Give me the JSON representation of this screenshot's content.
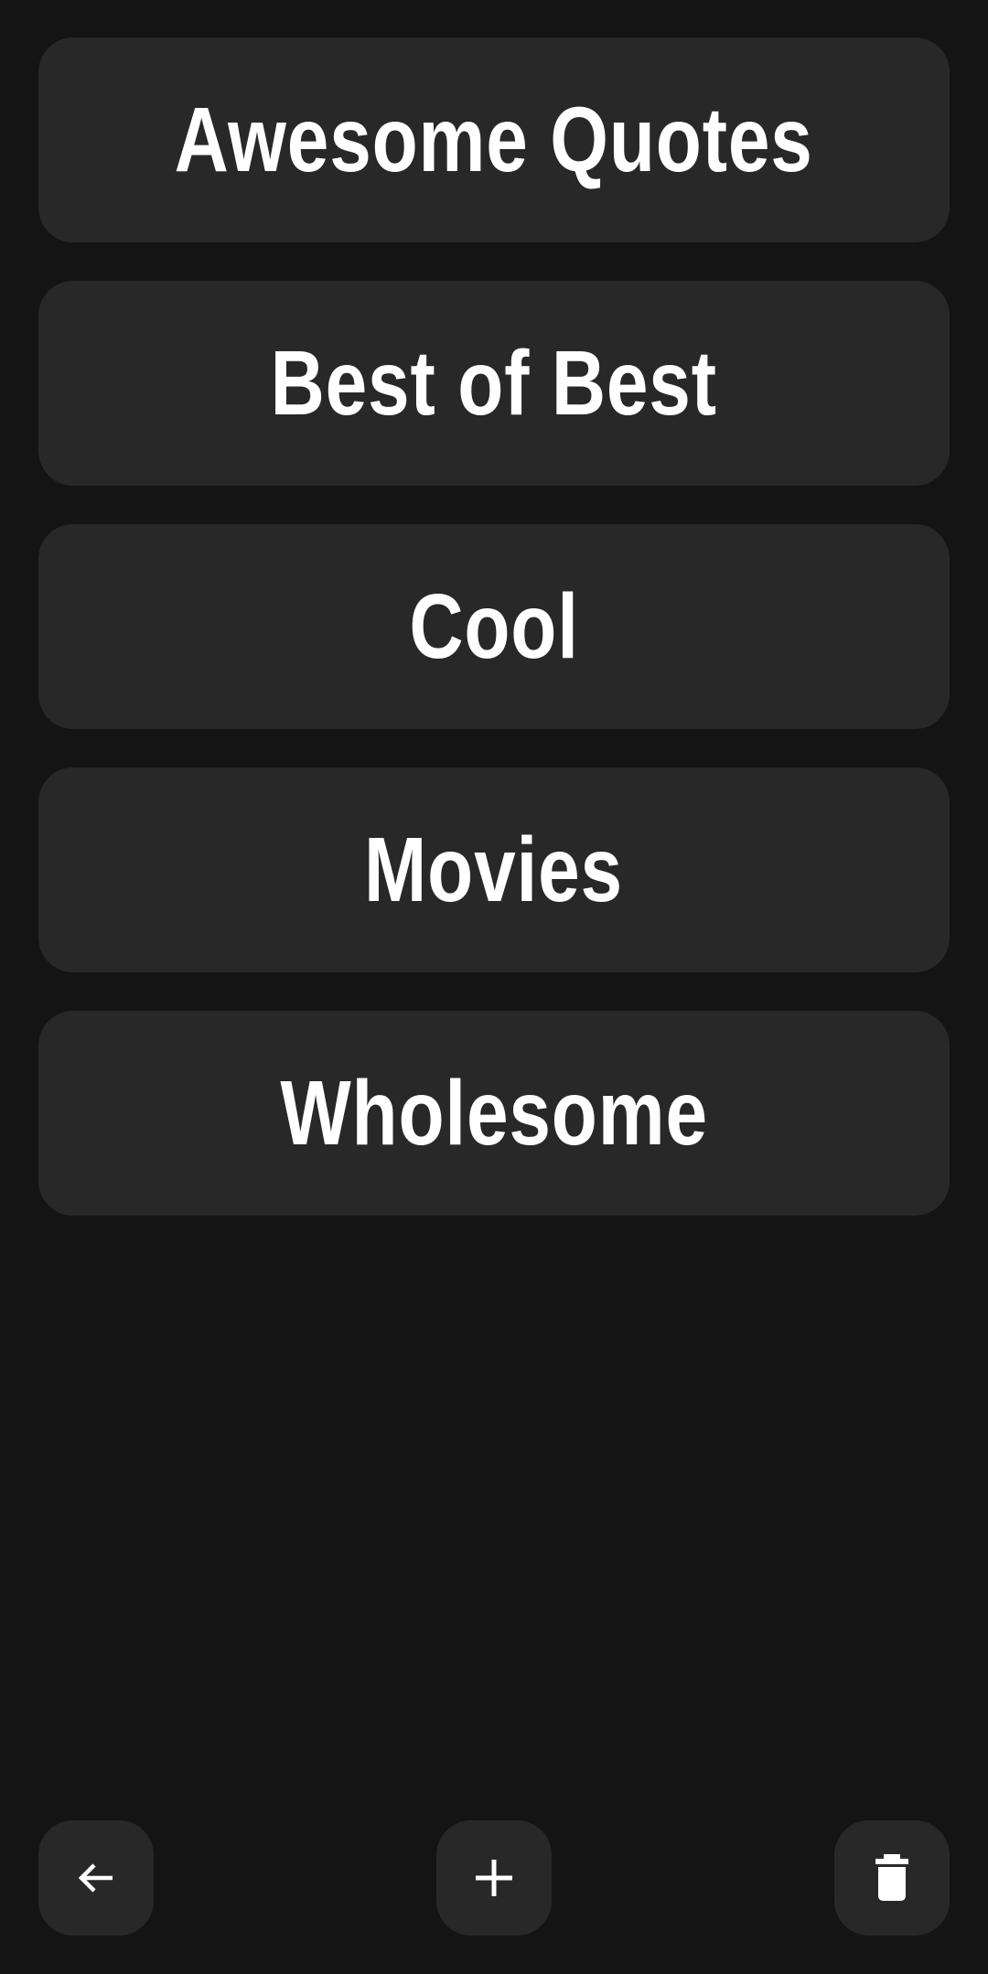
{
  "categories": [
    {
      "label": "Awesome Quotes"
    },
    {
      "label": "Best of Best"
    },
    {
      "label": "Cool"
    },
    {
      "label": "Movies"
    },
    {
      "label": "Wholesome"
    }
  ],
  "toolbar": {
    "back_icon": "arrow-left-icon",
    "add_icon": "plus-icon",
    "delete_icon": "trash-icon"
  },
  "colors": {
    "background": "#141414",
    "card": "#282828",
    "text": "#ffffff"
  }
}
